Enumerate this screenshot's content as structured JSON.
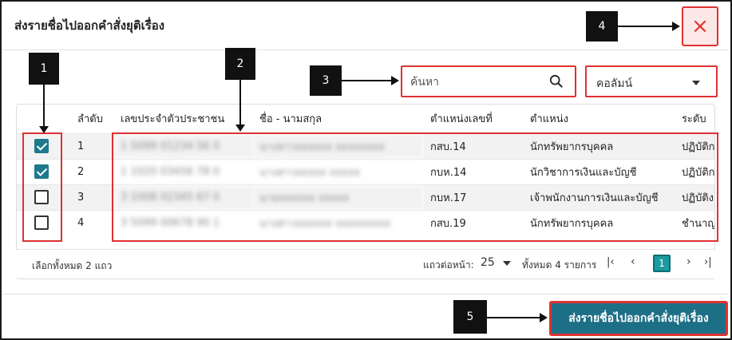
{
  "dialog": {
    "title": "ส่งรายชื่อไปออกคำสั่งยุติเรื่อง",
    "close_label": "×"
  },
  "search": {
    "placeholder": "ค้นหา",
    "column_select_label": "คอลัมน์"
  },
  "table": {
    "headers": [
      "ลำดับ",
      "เลขประจำตัวประชาชน",
      "ชื่อ - นามสกุล",
      "ตำแหน่งเลขที่",
      "ตำแหน่ง",
      "ระดับ"
    ],
    "rows": [
      {
        "checked": true,
        "no": "1",
        "id": "1 5099 01234 56 0",
        "name": "นางสาวxxxxxx xxxxxxxx",
        "pos_no": "กสบ.14",
        "position": "นักทรัพยากรบุคคล",
        "level": "ปฏิบัติก"
      },
      {
        "checked": true,
        "no": "2",
        "id": "1 1020 03456 78 0",
        "name": "นางสาวxxxxx xxxxx",
        "pos_no": "กบห.14",
        "position": "นักวิชาการเงินและบัญชี",
        "level": "ปฏิบัติก"
      },
      {
        "checked": false,
        "no": "3",
        "id": "3 1008 02345 67 0",
        "name": "นายxxxxxx xxxxx",
        "pos_no": "กบห.17",
        "position": "เจ้าพนักงานการเงินและบัญชี",
        "level": "ปฏิบัติง"
      },
      {
        "checked": false,
        "no": "4",
        "id": "3 5099 00678 90 1",
        "name": "นางสาวxxxxxx xxxxxxxxx",
        "pos_no": "กสบ.19",
        "position": "นักทรัพยากรบุคคล",
        "level": "ชำนาญ"
      }
    ]
  },
  "footer": {
    "selected_text": "เลือกทั้งหมด 2 แถว",
    "rows_per_page_label": "แถวต่อหน้า:",
    "rows_per_page_value": "25",
    "total_text": "ทั้งหมด 4 รายการ",
    "current_page": "1"
  },
  "annotations": [
    "1",
    "2",
    "3",
    "4",
    "5"
  ],
  "submit_label": "ส่งรายชื่อไปออกคำสั่งยุติเรื่อง",
  "colors": {
    "accent": "#1d6f86",
    "highlight": "#e03131",
    "page_active": "#1d9aa0"
  }
}
